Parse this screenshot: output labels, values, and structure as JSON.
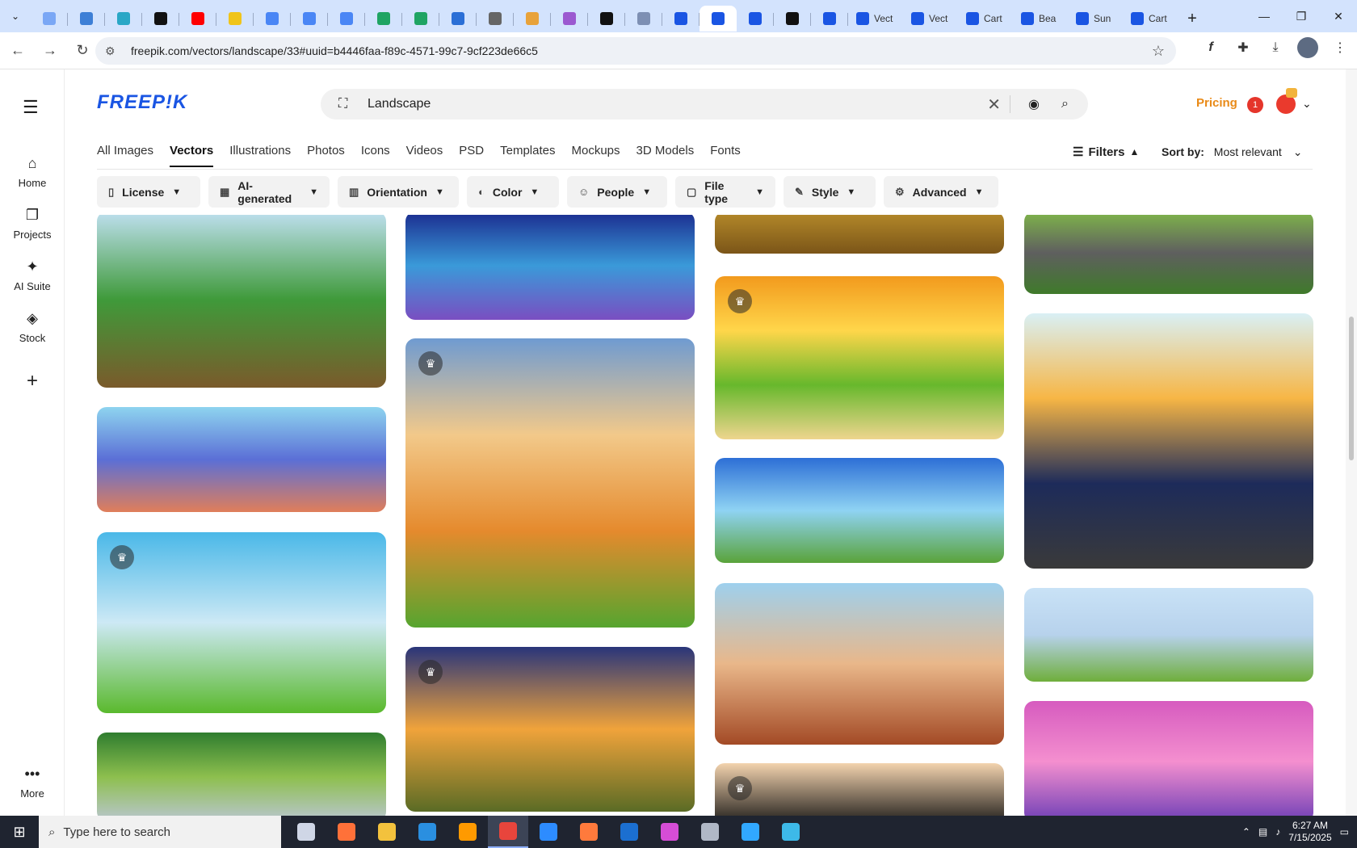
{
  "browser": {
    "tabs": [
      {
        "icon": "generic-site-icon",
        "color": "#7aa7f5"
      },
      {
        "icon": "vpn-shield-icon",
        "color": "#3d7fd6"
      },
      {
        "icon": "arrow-site-icon",
        "color": "#2aa7c6"
      },
      {
        "icon": "openai-icon",
        "color": "#111111"
      },
      {
        "icon": "youtube-icon",
        "color": "#ff0000"
      },
      {
        "icon": "lightning-icon",
        "color": "#f0c419"
      },
      {
        "icon": "docs-icon",
        "color": "#4a86f5"
      },
      {
        "icon": "docs-icon",
        "color": "#4a86f5"
      },
      {
        "icon": "docs-icon",
        "color": "#4a86f5"
      },
      {
        "icon": "sheets-icon",
        "color": "#1fa463"
      },
      {
        "icon": "sheets-icon",
        "color": "#1fa463"
      },
      {
        "icon": "word-icon",
        "color": "#2b6fd6"
      },
      {
        "icon": "globe-icon",
        "color": "#666666"
      },
      {
        "icon": "crown-site-icon",
        "color": "#e8a23a"
      },
      {
        "icon": "code-icon",
        "color": "#9b59d0"
      },
      {
        "icon": "ai-text-icon",
        "color": "#111111"
      },
      {
        "icon": "grid-site-icon",
        "color": "#7d8fb3"
      },
      {
        "icon": "freepik-icon",
        "color": "#1a55e3"
      },
      {
        "icon": "freepik-icon",
        "color": "#1a55e3",
        "active": true
      },
      {
        "icon": "freepik-icon",
        "color": "#1a55e3"
      },
      {
        "icon": "medium-icon",
        "color": "#111111"
      },
      {
        "icon": "freepik-icon",
        "color": "#1a55e3"
      }
    ],
    "titled_tabs": [
      "Vect",
      "Vect",
      "Cart",
      "Bea",
      "Sun",
      "Cart"
    ],
    "url": "freepik.com/vectors/landscape/33#uuid=b4446faa-f89c-4571-99c7-9cf223de66c5"
  },
  "rail": {
    "items": [
      {
        "label": "Home",
        "icon": "home-icon"
      },
      {
        "label": "Projects",
        "icon": "projects-icon"
      },
      {
        "label": "AI Suite",
        "icon": "sparkle-icon"
      },
      {
        "label": "Stock",
        "icon": "stock-icon"
      }
    ],
    "more_label": "More"
  },
  "header": {
    "logo": "FREEP!K",
    "search_value": "Landscape",
    "pricing": "Pricing",
    "notification_count": "1"
  },
  "categories": [
    {
      "label": "All Images"
    },
    {
      "label": "Vectors",
      "active": true
    },
    {
      "label": "Illustrations"
    },
    {
      "label": "Photos"
    },
    {
      "label": "Icons"
    },
    {
      "label": "Videos"
    },
    {
      "label": "PSD"
    },
    {
      "label": "Templates"
    },
    {
      "label": "Mockups"
    },
    {
      "label": "3D Models"
    },
    {
      "label": "Fonts"
    }
  ],
  "toolbar": {
    "filters_label": "Filters",
    "sort_label": "Sort by:",
    "sort_value": "Most relevant"
  },
  "chips": [
    {
      "label": "License",
      "icon": "license-icon"
    },
    {
      "label": "AI-generated",
      "icon": "ai-generated-icon"
    },
    {
      "label": "Orientation",
      "icon": "orientation-icon"
    },
    {
      "label": "Color",
      "icon": "palette-icon"
    },
    {
      "label": "People",
      "icon": "people-icon"
    },
    {
      "label": "File type",
      "icon": "file-icon"
    },
    {
      "label": "Style",
      "icon": "brush-icon"
    },
    {
      "label": "Advanced",
      "icon": "settings-icon"
    }
  ],
  "images": [
    {
      "name": "volcano-forest-card",
      "premium": false,
      "colors": [
        "#bfe0f0",
        "#3f9a3a",
        "#7a5a2b"
      ]
    },
    {
      "name": "camper-lake-card",
      "premium": false,
      "colors": [
        "#8ed4ef",
        "#5b6fd6",
        "#e07e5a"
      ]
    },
    {
      "name": "hill-tree-card",
      "premium": true,
      "colors": [
        "#4ab8e8",
        "#cde9f5",
        "#5ab92d"
      ]
    },
    {
      "name": "waterfall-jungle-card",
      "premium": false,
      "colors": [
        "#2f7d2f",
        "#8dbf4e",
        "#b9c6cf"
      ]
    },
    {
      "name": "night-lake-card",
      "premium": false,
      "colors": [
        "#1b2c8f",
        "#3a9ad9",
        "#7a4ec1"
      ]
    },
    {
      "name": "autumn-field-card",
      "premium": true,
      "colors": [
        "#6f9bd1",
        "#f2c98a",
        "#e58a2d",
        "#56a52f"
      ]
    },
    {
      "name": "sunset-tree-road-card",
      "premium": true,
      "colors": [
        "#29357a",
        "#f0a33b",
        "#5a6b25"
      ]
    },
    {
      "name": "dirt-ground-card",
      "premium": false,
      "colors": [
        "#b58a2a",
        "#7b5518"
      ]
    },
    {
      "name": "sunny-tree-meadow-card",
      "premium": true,
      "colors": [
        "#f29a1d",
        "#ffd64a",
        "#67b82c",
        "#eed58e"
      ]
    },
    {
      "name": "red-house-shore-card",
      "premium": false,
      "colors": [
        "#2d6fd6",
        "#8fd3f3",
        "#5aa33a"
      ]
    },
    {
      "name": "desert-canyon-card",
      "premium": false,
      "colors": [
        "#9ed0ee",
        "#e9b78a",
        "#a34a26"
      ]
    },
    {
      "name": "bird-silhouette-card",
      "premium": true,
      "colors": [
        "#f3d3ae",
        "#111111"
      ]
    },
    {
      "name": "rocky-meadow-card",
      "premium": false,
      "colors": [
        "#7fb54a",
        "#5f5f5f",
        "#3f7a2a"
      ]
    },
    {
      "name": "desert-road-triptych-card",
      "premium": false,
      "colors": [
        "#d9f0f5",
        "#f7b645",
        "#1d2b5a",
        "#3a3a3a"
      ]
    },
    {
      "name": "mountain-cows-card",
      "premium": false,
      "colors": [
        "#c9e2f6",
        "#b7d2ec",
        "#6fae3b"
      ]
    },
    {
      "name": "pink-sunset-palms-card",
      "premium": false,
      "colors": [
        "#d65bbf",
        "#f48fcf",
        "#6e3fb6"
      ]
    }
  ],
  "taskbar": {
    "search_placeholder": "Type here to search",
    "apps": [
      {
        "icon": "task-view-icon",
        "color": "#cfd6e6"
      },
      {
        "icon": "firefox-icon",
        "color": "#ff7139"
      },
      {
        "icon": "file-explorer-icon",
        "color": "#f3c23d"
      },
      {
        "icon": "vscode-icon",
        "color": "#2a8fe0"
      },
      {
        "icon": "illustrator-icon",
        "color": "#ff9a00"
      },
      {
        "icon": "chrome-icon",
        "color": "#e8453c",
        "active": true
      },
      {
        "icon": "zoom-icon",
        "color": "#2d8cff"
      },
      {
        "icon": "app-icon",
        "color": "#ff7a3c"
      },
      {
        "icon": "outlook-icon",
        "color": "#1b6fd0"
      },
      {
        "icon": "photos-icon",
        "color": "#d64dd6"
      },
      {
        "icon": "pen-icon",
        "color": "#b0b8c6"
      },
      {
        "icon": "photoshop-icon",
        "color": "#31a8ff"
      },
      {
        "icon": "app-icon",
        "color": "#3db9e8"
      }
    ],
    "time": "6:27 AM",
    "date": "7/15/2025"
  }
}
